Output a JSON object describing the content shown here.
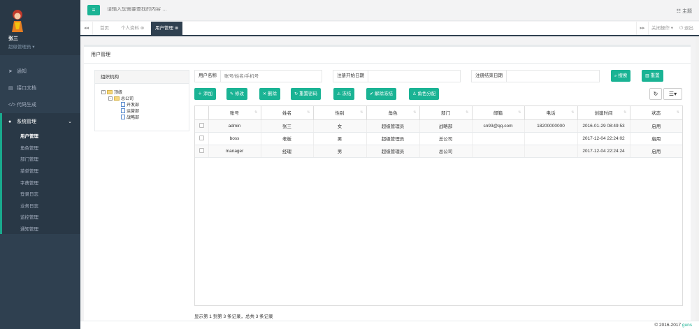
{
  "sidebar": {
    "user_name": "张三",
    "user_role": "超级管理员",
    "menu": [
      {
        "label": "通知",
        "icon": "paper-plane-icon"
      },
      {
        "label": "接口文档",
        "icon": "file-icon"
      },
      {
        "label": "代码生成",
        "icon": "code-icon"
      },
      {
        "label": "系统管理",
        "icon": "user-icon"
      }
    ],
    "submenu": [
      "用户管理",
      "角色管理",
      "部门管理",
      "菜单管理",
      "字典管理",
      "登录日志",
      "业务日志",
      "监控管理",
      "通知管理"
    ]
  },
  "topbar": {
    "search_placeholder": "请输入您需要查找的内容 …",
    "theme_label": "主题"
  },
  "tabs": {
    "items": [
      "首页",
      "个人资料",
      "用户管理"
    ],
    "close_ops": "关闭操作",
    "logout": "退出"
  },
  "page": {
    "title": "用户管理",
    "tree_title": "组织机构",
    "tree": {
      "root": "顶级",
      "company": "总公司",
      "depts": [
        "开发部",
        "运营部",
        "战略部"
      ]
    },
    "filters": {
      "username_label": "用户名称",
      "username_placeholder": "账号/姓名/手机号",
      "start_label": "注册开始日期",
      "end_label": "注册结束日期",
      "search_button": "搜索",
      "reset_button": "重置"
    },
    "actions": [
      "添加",
      "修改",
      "删除",
      "重置密码",
      "冻结",
      "解除冻结",
      "角色分配"
    ],
    "columns": [
      "账号",
      "姓名",
      "性别",
      "角色",
      "部门",
      "邮箱",
      "电话",
      "创建时间",
      "状态"
    ],
    "rows": [
      [
        "admin",
        "张三",
        "女",
        "超级管理员",
        "战略部",
        "sn93@qq.com",
        "18200000000",
        "2016-01-29 08:49:53",
        "启用"
      ],
      [
        "boss",
        "老板",
        "男",
        "超级管理员",
        "总公司",
        "",
        "",
        "2017-12-04 22:24:02",
        "启用"
      ],
      [
        "manager",
        "经理",
        "男",
        "超级管理员",
        "总公司",
        "",
        "",
        "2017-12-04 22:24:24",
        "启用"
      ]
    ],
    "pagination": "显示第 1 到第 3 条记录，总共 3 条记录"
  },
  "footer": {
    "copyright": "© 2016-2017",
    "brand": "guns"
  },
  "colors": {
    "accent": "#1ab394",
    "sidebar": "#2f4050"
  }
}
